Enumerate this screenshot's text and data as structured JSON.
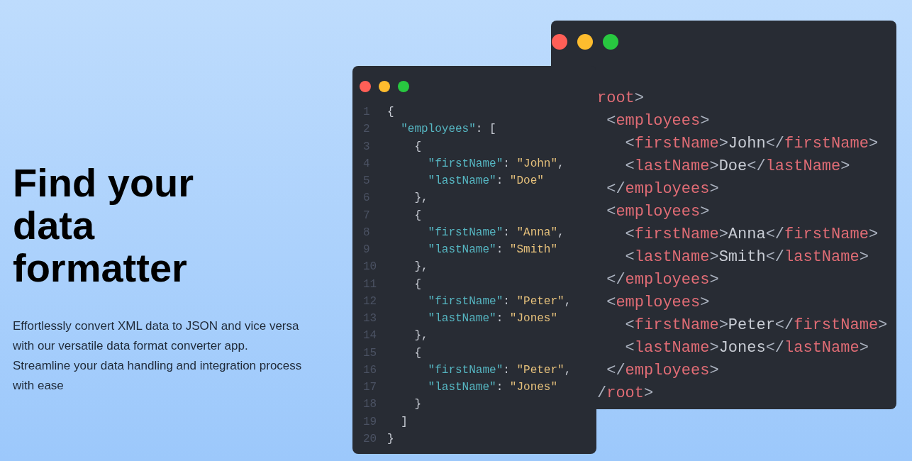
{
  "hero": {
    "heading": "Find your data formatter",
    "description": "Effortlessly convert XML data to JSON and vice versa with our versatile data format converter app. Streamline your data handling and integration process with ease"
  },
  "xml_window": {
    "lines": [
      [
        {
          "kind": "tag",
          "text": "root"
        },
        {
          "kind": "bracket",
          "text": ">"
        }
      ],
      [
        {
          "kind": "bracket",
          "text": " <"
        },
        {
          "kind": "tag",
          "text": "employees"
        },
        {
          "kind": "bracket",
          "text": ">"
        }
      ],
      [
        {
          "kind": "bracket",
          "text": "   <"
        },
        {
          "kind": "tag",
          "text": "firstName"
        },
        {
          "kind": "bracket",
          "text": ">"
        },
        {
          "kind": "text",
          "text": "John"
        },
        {
          "kind": "bracket",
          "text": "</"
        },
        {
          "kind": "tag",
          "text": "firstName"
        },
        {
          "kind": "bracket",
          "text": ">"
        }
      ],
      [
        {
          "kind": "bracket",
          "text": "   <"
        },
        {
          "kind": "tag",
          "text": "lastName"
        },
        {
          "kind": "bracket",
          "text": ">"
        },
        {
          "kind": "text",
          "text": "Doe"
        },
        {
          "kind": "bracket",
          "text": "</"
        },
        {
          "kind": "tag",
          "text": "lastName"
        },
        {
          "kind": "bracket",
          "text": ">"
        }
      ],
      [
        {
          "kind": "bracket",
          "text": " </"
        },
        {
          "kind": "tag",
          "text": "employees"
        },
        {
          "kind": "bracket",
          "text": ">"
        }
      ],
      [
        {
          "kind": "bracket",
          "text": " <"
        },
        {
          "kind": "tag",
          "text": "employees"
        },
        {
          "kind": "bracket",
          "text": ">"
        }
      ],
      [
        {
          "kind": "bracket",
          "text": "   <"
        },
        {
          "kind": "tag",
          "text": "firstName"
        },
        {
          "kind": "bracket",
          "text": ">"
        },
        {
          "kind": "text",
          "text": "Anna"
        },
        {
          "kind": "bracket",
          "text": "</"
        },
        {
          "kind": "tag",
          "text": "firstName"
        },
        {
          "kind": "bracket",
          "text": ">"
        }
      ],
      [
        {
          "kind": "bracket",
          "text": "   <"
        },
        {
          "kind": "tag",
          "text": "lastName"
        },
        {
          "kind": "bracket",
          "text": ">"
        },
        {
          "kind": "text",
          "text": "Smith"
        },
        {
          "kind": "bracket",
          "text": "</"
        },
        {
          "kind": "tag",
          "text": "lastName"
        },
        {
          "kind": "bracket",
          "text": ">"
        }
      ],
      [
        {
          "kind": "bracket",
          "text": " </"
        },
        {
          "kind": "tag",
          "text": "employees"
        },
        {
          "kind": "bracket",
          "text": ">"
        }
      ],
      [
        {
          "kind": "bracket",
          "text": " <"
        },
        {
          "kind": "tag",
          "text": "employees"
        },
        {
          "kind": "bracket",
          "text": ">"
        }
      ],
      [
        {
          "kind": "bracket",
          "text": "   <"
        },
        {
          "kind": "tag",
          "text": "firstName"
        },
        {
          "kind": "bracket",
          "text": ">"
        },
        {
          "kind": "text",
          "text": "Peter"
        },
        {
          "kind": "bracket",
          "text": "</"
        },
        {
          "kind": "tag",
          "text": "firstName"
        },
        {
          "kind": "bracket",
          "text": ">"
        }
      ],
      [
        {
          "kind": "bracket",
          "text": "   <"
        },
        {
          "kind": "tag",
          "text": "lastName"
        },
        {
          "kind": "bracket",
          "text": ">"
        },
        {
          "kind": "text",
          "text": "Jones"
        },
        {
          "kind": "bracket",
          "text": "</"
        },
        {
          "kind": "tag",
          "text": "lastName"
        },
        {
          "kind": "bracket",
          "text": ">"
        }
      ],
      [
        {
          "kind": "bracket",
          "text": " </"
        },
        {
          "kind": "tag",
          "text": "employees"
        },
        {
          "kind": "bracket",
          "text": ">"
        }
      ],
      [
        {
          "kind": "bracket",
          "text": "/"
        },
        {
          "kind": "tag",
          "text": "root"
        },
        {
          "kind": "bracket",
          "text": ">"
        }
      ]
    ]
  },
  "json_window": {
    "lines": [
      {
        "number": "1",
        "tokens": [
          {
            "kind": "punct",
            "text": "{"
          }
        ]
      },
      {
        "number": "2",
        "tokens": [
          {
            "kind": "key",
            "text": "  \"employees\""
          },
          {
            "kind": "punct",
            "text": ": ["
          }
        ]
      },
      {
        "number": "3",
        "tokens": [
          {
            "kind": "punct",
            "text": "    {"
          }
        ]
      },
      {
        "number": "4",
        "tokens": [
          {
            "kind": "key",
            "text": "      \"firstName\""
          },
          {
            "kind": "punct",
            "text": ": "
          },
          {
            "kind": "string",
            "text": "\"John\""
          },
          {
            "kind": "punct",
            "text": ","
          }
        ]
      },
      {
        "number": "5",
        "tokens": [
          {
            "kind": "key",
            "text": "      \"lastName\""
          },
          {
            "kind": "punct",
            "text": ": "
          },
          {
            "kind": "string",
            "text": "\"Doe\""
          }
        ]
      },
      {
        "number": "6",
        "tokens": [
          {
            "kind": "punct",
            "text": "    },"
          }
        ]
      },
      {
        "number": "7",
        "tokens": [
          {
            "kind": "punct",
            "text": "    {"
          }
        ]
      },
      {
        "number": "8",
        "tokens": [
          {
            "kind": "key",
            "text": "      \"firstName\""
          },
          {
            "kind": "punct",
            "text": ": "
          },
          {
            "kind": "string",
            "text": "\"Anna\""
          },
          {
            "kind": "punct",
            "text": ","
          }
        ]
      },
      {
        "number": "9",
        "tokens": [
          {
            "kind": "key",
            "text": "      \"lastName\""
          },
          {
            "kind": "punct",
            "text": ": "
          },
          {
            "kind": "string",
            "text": "\"Smith\""
          }
        ]
      },
      {
        "number": "10",
        "tokens": [
          {
            "kind": "punct",
            "text": "    },"
          }
        ]
      },
      {
        "number": "11",
        "tokens": [
          {
            "kind": "punct",
            "text": "    {"
          }
        ]
      },
      {
        "number": "12",
        "tokens": [
          {
            "kind": "key",
            "text": "      \"firstName\""
          },
          {
            "kind": "punct",
            "text": ": "
          },
          {
            "kind": "string",
            "text": "\"Peter\""
          },
          {
            "kind": "punct",
            "text": ","
          }
        ]
      },
      {
        "number": "13",
        "tokens": [
          {
            "kind": "key",
            "text": "      \"lastName\""
          },
          {
            "kind": "punct",
            "text": ": "
          },
          {
            "kind": "string",
            "text": "\"Jones\""
          }
        ]
      },
      {
        "number": "14",
        "tokens": [
          {
            "kind": "punct",
            "text": "    },"
          }
        ]
      },
      {
        "number": "15",
        "tokens": [
          {
            "kind": "punct",
            "text": "    {"
          }
        ]
      },
      {
        "number": "16",
        "tokens": [
          {
            "kind": "key",
            "text": "      \"firstName\""
          },
          {
            "kind": "punct",
            "text": ": "
          },
          {
            "kind": "string",
            "text": "\"Peter\""
          },
          {
            "kind": "punct",
            "text": ","
          }
        ]
      },
      {
        "number": "17",
        "tokens": [
          {
            "kind": "key",
            "text": "      \"lastName\""
          },
          {
            "kind": "punct",
            "text": ": "
          },
          {
            "kind": "string",
            "text": "\"Jones\""
          }
        ]
      },
      {
        "number": "18",
        "tokens": [
          {
            "kind": "punct",
            "text": "    }"
          }
        ]
      },
      {
        "number": "19",
        "tokens": [
          {
            "kind": "punct",
            "text": "  ]"
          }
        ]
      },
      {
        "number": "20",
        "tokens": [
          {
            "kind": "punct",
            "text": "}"
          }
        ]
      }
    ]
  }
}
